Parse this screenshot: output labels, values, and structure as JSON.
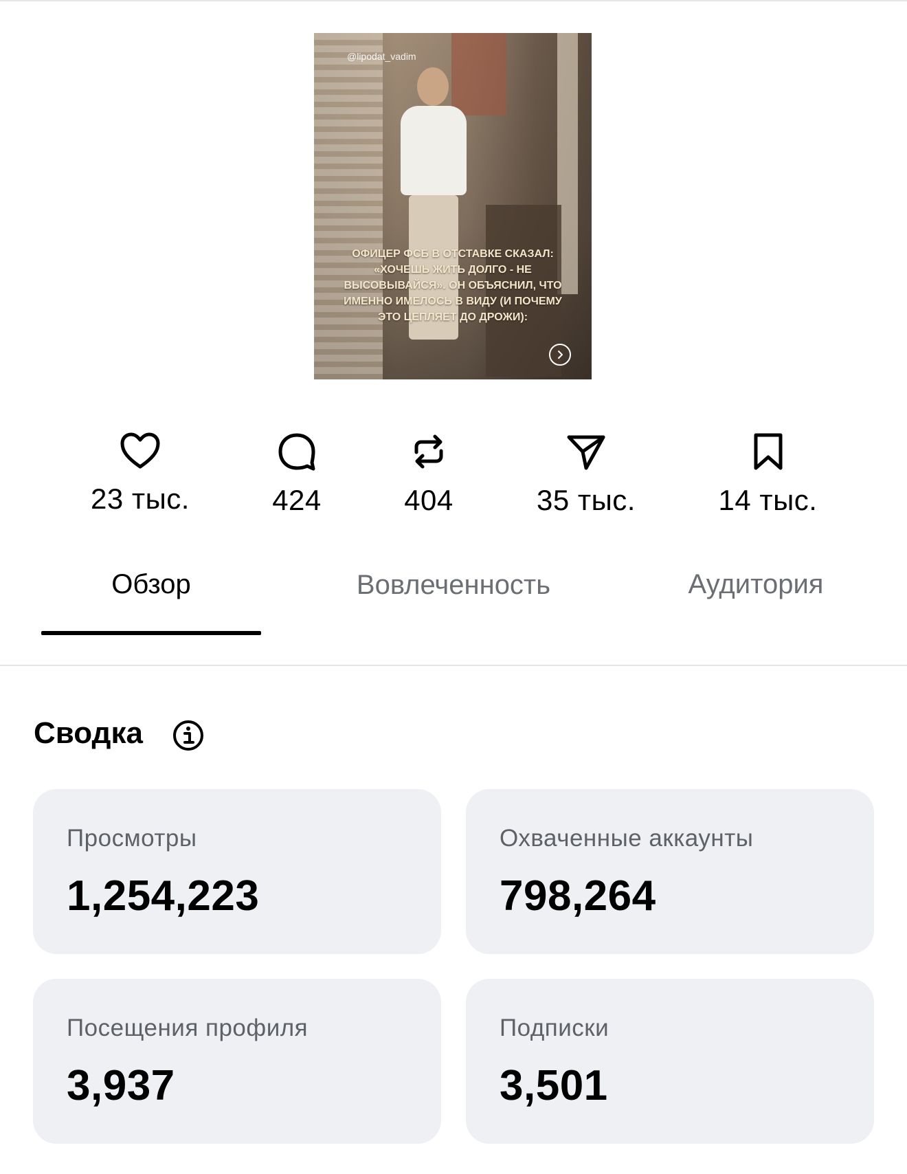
{
  "post": {
    "handle": "@lipodat_vadim",
    "overlay_text": "Офицер ФСБ в отставке сказал: «Хочешь жить долго - не высовывайся». Он объяснил, что именно имелось в виду (и почему это цепляет до дрожи):"
  },
  "stats": [
    {
      "icon": "heart-icon",
      "value": "23 тыс."
    },
    {
      "icon": "comment-icon",
      "value": "424"
    },
    {
      "icon": "repost-icon",
      "value": "404"
    },
    {
      "icon": "share-icon",
      "value": "35 тыс."
    },
    {
      "icon": "bookmark-icon",
      "value": "14 тыс."
    }
  ],
  "tabs": [
    {
      "label": "Обзор",
      "active": true
    },
    {
      "label": "Вовлеченность",
      "active": false
    },
    {
      "label": "Аудитория",
      "active": false
    }
  ],
  "summary": {
    "title": "Сводка",
    "cards": [
      {
        "label": "Просмотры",
        "value": "1,254,223"
      },
      {
        "label": "Охваченные аккаунты",
        "value": "798,264"
      },
      {
        "label": "Посещения профиля",
        "value": "3,937"
      },
      {
        "label": "Подписки",
        "value": "3,501"
      }
    ]
  },
  "colors": {
    "background": "#ffffff",
    "card_background": "#eff0f4",
    "inactive_tab": "#6b6e73",
    "label_gray": "#5e6166"
  }
}
